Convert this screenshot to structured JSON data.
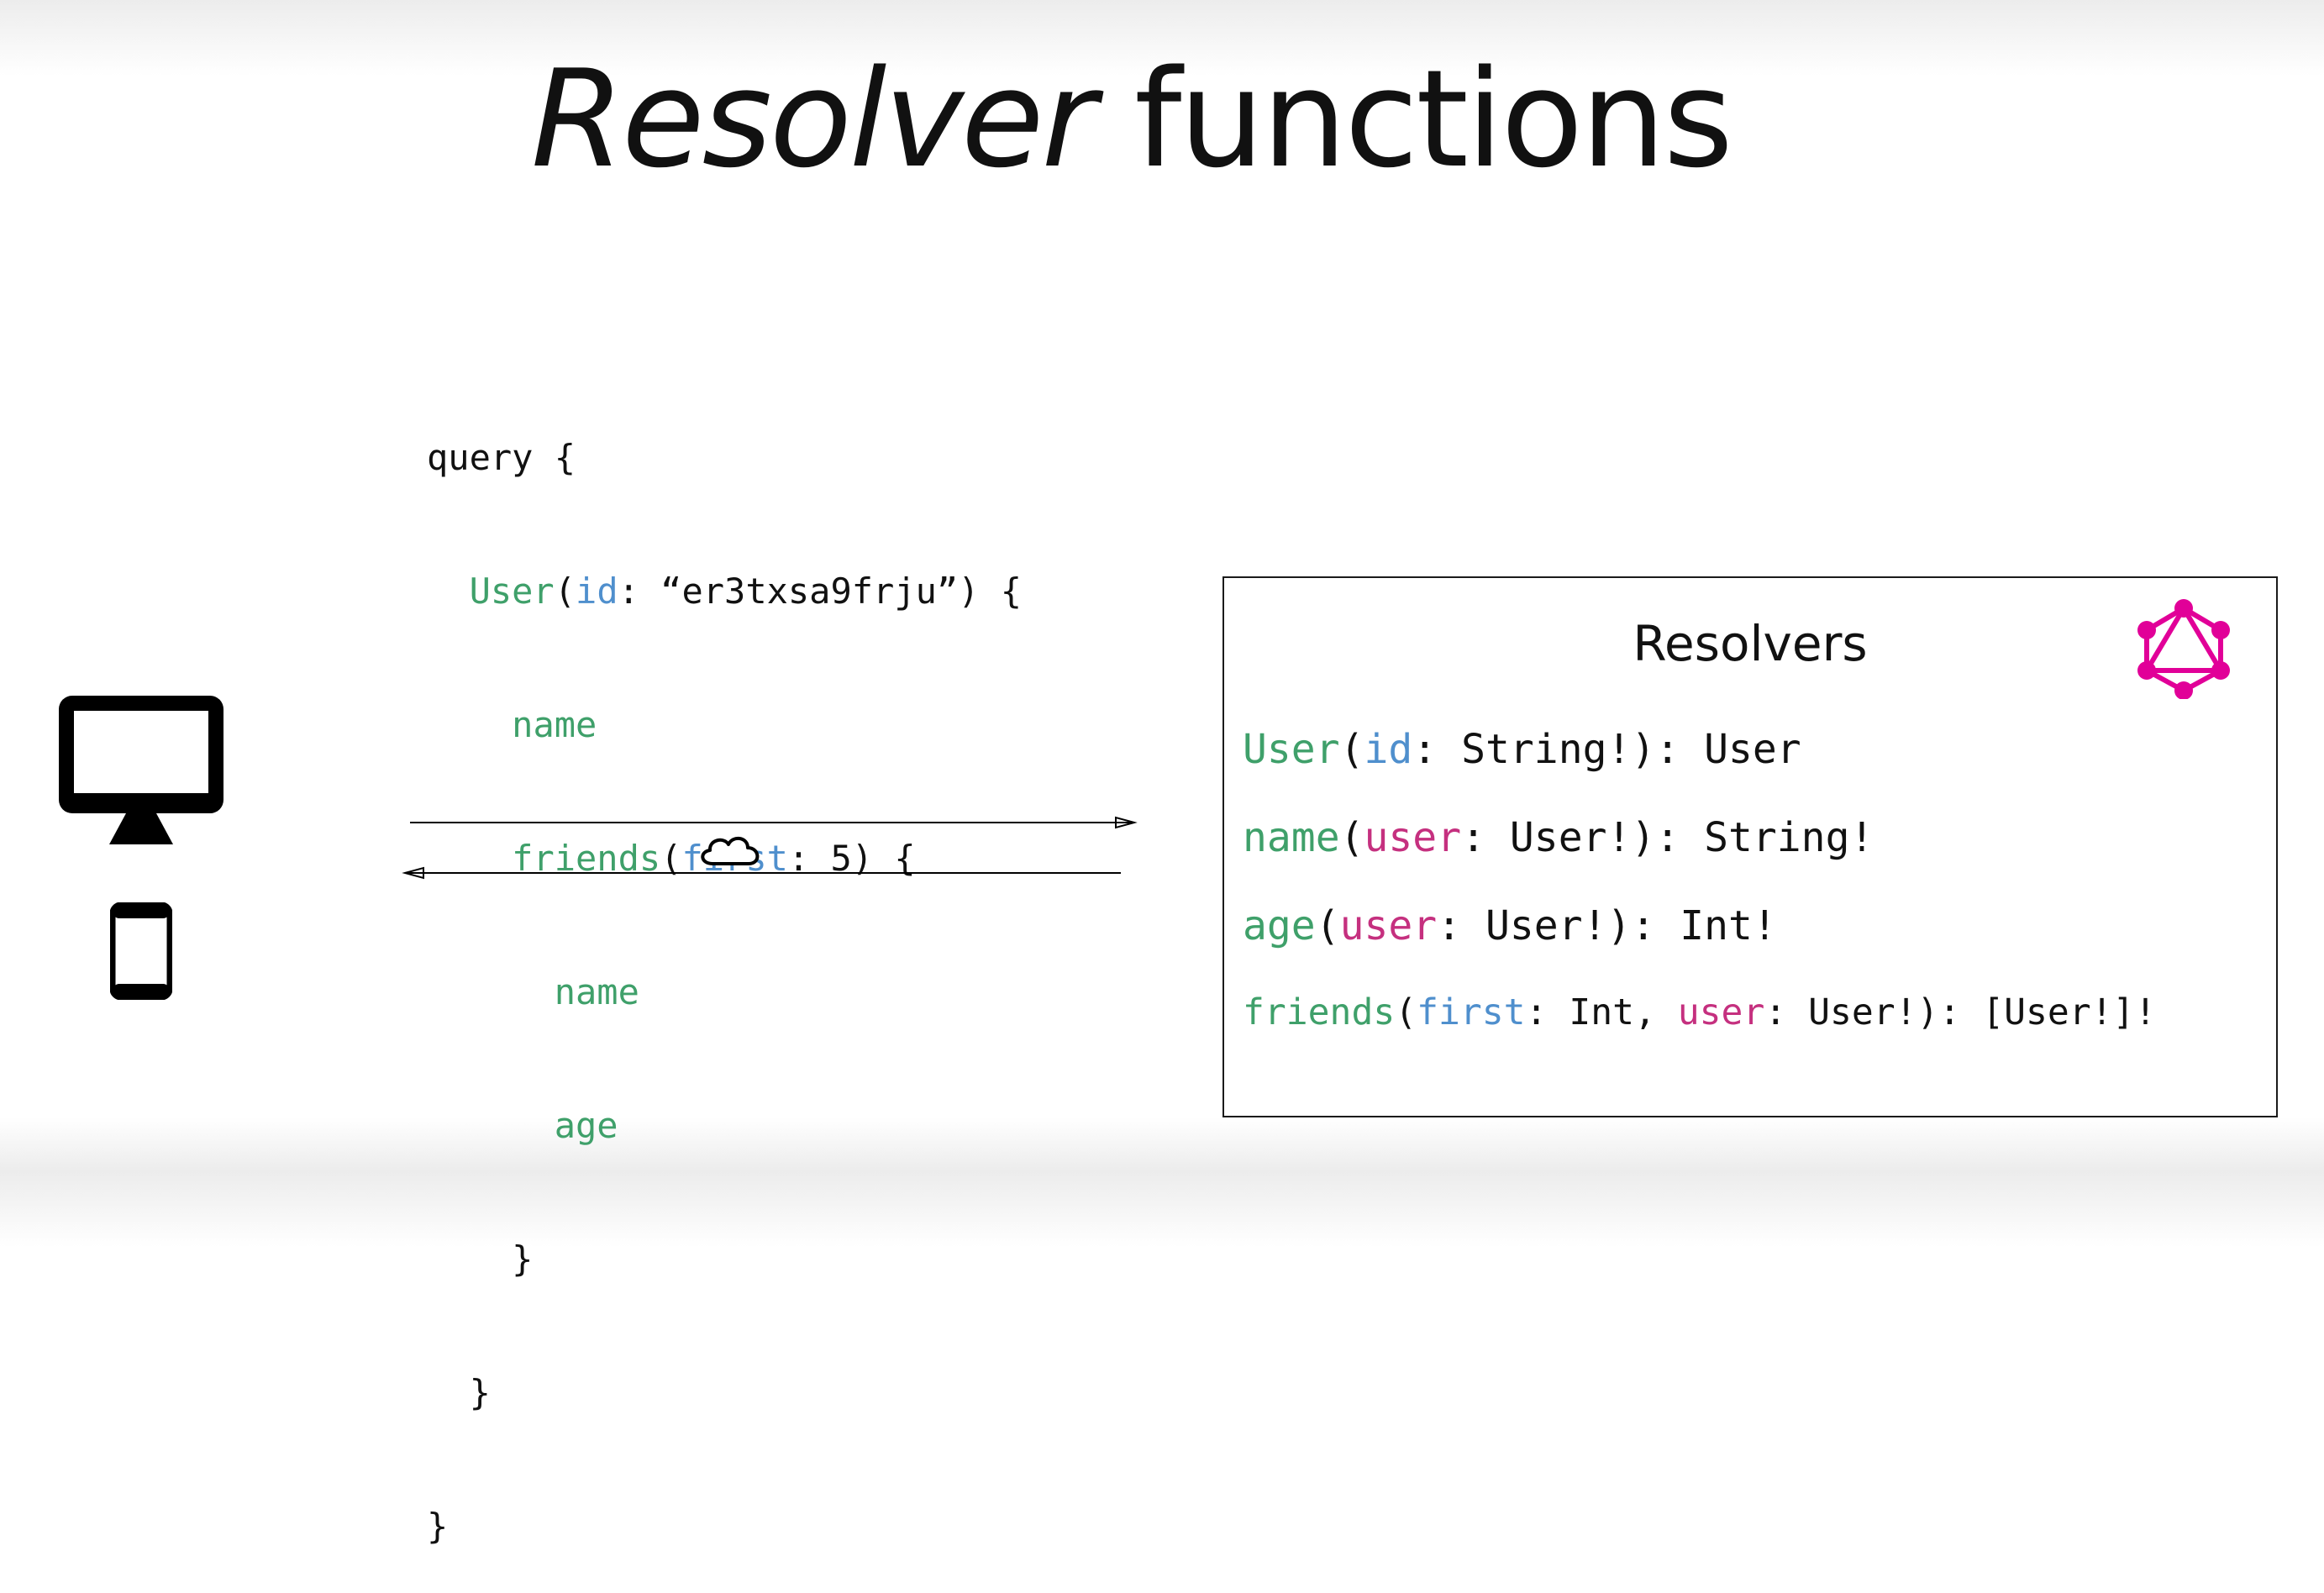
{
  "title": {
    "emphasis": "Resolver",
    "rest": " functions"
  },
  "query_code": {
    "l1": {
      "text": "query {"
    },
    "l2": {
      "indent": "  ",
      "field": "User",
      "open": "(",
      "arg": "id",
      "rest": ": “er3txsa9frju”) {"
    },
    "l3": {
      "indent": "    ",
      "field": "name"
    },
    "l4": {
      "indent": "    ",
      "field": "friends",
      "open": "(",
      "arg": "first",
      "rest": ": 5) {"
    },
    "l5": {
      "indent": "      ",
      "field": "name"
    },
    "l6": {
      "indent": "      ",
      "field": "age"
    },
    "l7": {
      "text": "    }"
    },
    "l8": {
      "text": "  }"
    },
    "l9": {
      "text": "}"
    }
  },
  "resolvers_panel": {
    "title": "Resolvers",
    "logo_icon": "graphql-logo-icon",
    "signatures": [
      {
        "name": "User",
        "open": "(",
        "a1": "id",
        "r1": ": String!): User"
      },
      {
        "name": "name",
        "open": "(",
        "a1": "user",
        "r1": ": User!): String!"
      },
      {
        "name": "age",
        "open": "(",
        "a1": "user",
        "r1": ": User!): Int!"
      },
      {
        "name": "friends",
        "open": "(",
        "a1": "first",
        "r1": ": Int, ",
        "a2": "user",
        "r2": ": User!): [User!]!"
      }
    ]
  },
  "icons": {
    "client_desktop": "desktop-monitor-icon",
    "client_mobile": "mobile-phone-icon",
    "network": "cloud-icon",
    "request_arrow": "arrow-right-icon",
    "response_arrow": "arrow-left-icon"
  },
  "colors": {
    "field": "#3fa06a",
    "argument": "#4f8fcd",
    "user_argument": "#c5307f",
    "graphql_logo": "#e10098",
    "text": "#111111"
  }
}
